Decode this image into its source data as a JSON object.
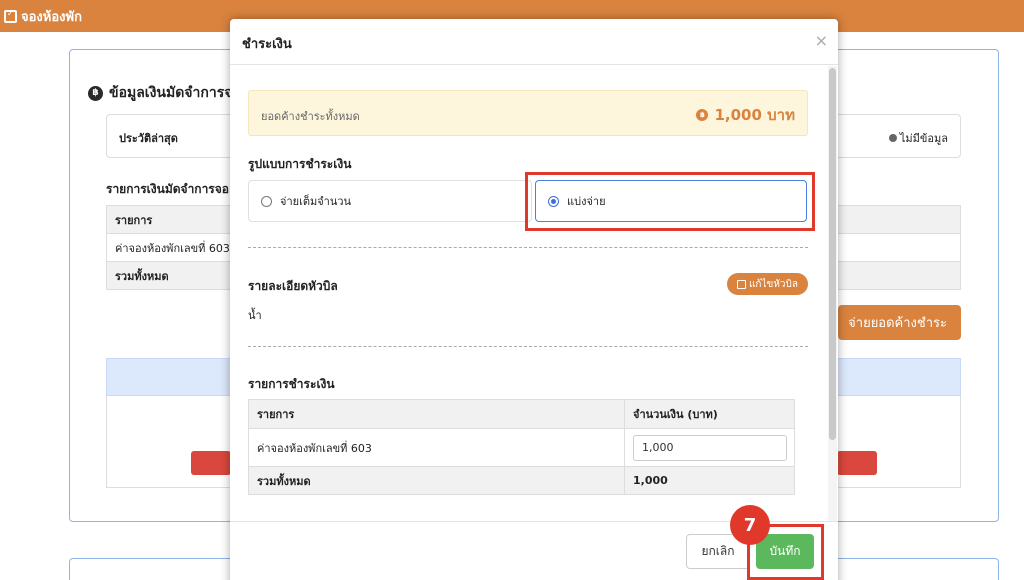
{
  "app": {
    "title": "จองห้องพัก"
  },
  "background": {
    "section_title": "ข้อมูลเงินมัดจำการจอ",
    "latest_label": "ประวัติล่าสุด",
    "latest_status": "ไม่มีข้อมูล",
    "list_title": "รายการเงินมัดจำการจอ",
    "table": {
      "header": "รายการ",
      "row": "ค่าจองห้องพักเลขที่ 603",
      "total": "รวมทั้งหมด"
    },
    "pay_button": "จ่ายยอดค้างชำระ"
  },
  "modal": {
    "title": "ชำระเงิน",
    "close": "×",
    "due_label": "ยอดค้างชำระทั้งหมด",
    "due_amount": "1,000 บาท",
    "payment_type_title": "รูปแบบการชำระเงิน",
    "options": [
      {
        "label": "จ่ายเต็มจำนวน",
        "selected": false
      },
      {
        "label": "แบ่งจ่าย",
        "selected": true
      }
    ],
    "bill_title": "รายละเอียดหัวบิล",
    "edit_bill_button": "แก้ไขหัวบิล",
    "bill_value": "น้ำ",
    "payment_list_title": "รายการชำระเงิน",
    "table": {
      "col_item": "รายการ",
      "col_amount": "จำนวนเงิน (บาท)",
      "row_item": "ค่าจองห้องพักเลขที่ 603",
      "row_amount": "1,000",
      "total_label": "รวมทั้งหมด",
      "total_amount": "1,000"
    },
    "cancel_button": "ยกเลิก",
    "save_button": "บันทึก"
  },
  "step_badge": "7",
  "colors": {
    "brand_orange": "#d9833f",
    "highlight_red": "#e0382b",
    "save_green": "#5cb85c",
    "radio_blue": "#3a6fe0"
  }
}
